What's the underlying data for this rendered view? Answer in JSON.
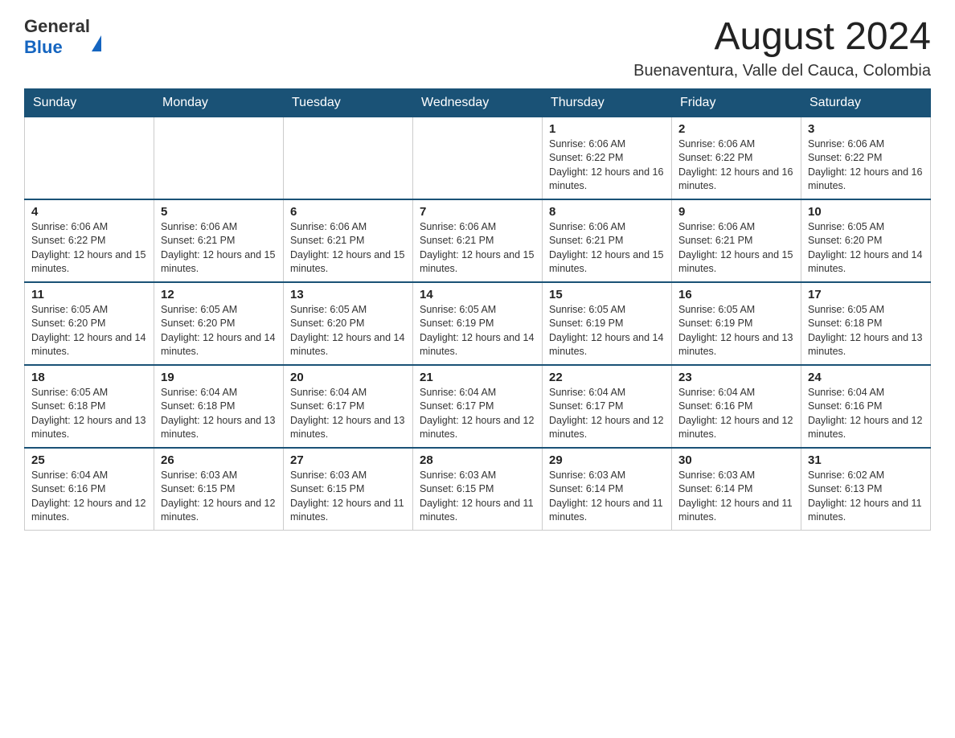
{
  "header": {
    "logo_general": "General",
    "logo_blue": "Blue",
    "month_title": "August 2024",
    "subtitle": "Buenaventura, Valle del Cauca, Colombia"
  },
  "days_of_week": [
    "Sunday",
    "Monday",
    "Tuesday",
    "Wednesday",
    "Thursday",
    "Friday",
    "Saturday"
  ],
  "weeks": [
    [
      {
        "day": "",
        "sunrise": "",
        "sunset": "",
        "daylight": ""
      },
      {
        "day": "",
        "sunrise": "",
        "sunset": "",
        "daylight": ""
      },
      {
        "day": "",
        "sunrise": "",
        "sunset": "",
        "daylight": ""
      },
      {
        "day": "",
        "sunrise": "",
        "sunset": "",
        "daylight": ""
      },
      {
        "day": "1",
        "sunrise": "Sunrise: 6:06 AM",
        "sunset": "Sunset: 6:22 PM",
        "daylight": "Daylight: 12 hours and 16 minutes."
      },
      {
        "day": "2",
        "sunrise": "Sunrise: 6:06 AM",
        "sunset": "Sunset: 6:22 PM",
        "daylight": "Daylight: 12 hours and 16 minutes."
      },
      {
        "day": "3",
        "sunrise": "Sunrise: 6:06 AM",
        "sunset": "Sunset: 6:22 PM",
        "daylight": "Daylight: 12 hours and 16 minutes."
      }
    ],
    [
      {
        "day": "4",
        "sunrise": "Sunrise: 6:06 AM",
        "sunset": "Sunset: 6:22 PM",
        "daylight": "Daylight: 12 hours and 15 minutes."
      },
      {
        "day": "5",
        "sunrise": "Sunrise: 6:06 AM",
        "sunset": "Sunset: 6:21 PM",
        "daylight": "Daylight: 12 hours and 15 minutes."
      },
      {
        "day": "6",
        "sunrise": "Sunrise: 6:06 AM",
        "sunset": "Sunset: 6:21 PM",
        "daylight": "Daylight: 12 hours and 15 minutes."
      },
      {
        "day": "7",
        "sunrise": "Sunrise: 6:06 AM",
        "sunset": "Sunset: 6:21 PM",
        "daylight": "Daylight: 12 hours and 15 minutes."
      },
      {
        "day": "8",
        "sunrise": "Sunrise: 6:06 AM",
        "sunset": "Sunset: 6:21 PM",
        "daylight": "Daylight: 12 hours and 15 minutes."
      },
      {
        "day": "9",
        "sunrise": "Sunrise: 6:06 AM",
        "sunset": "Sunset: 6:21 PM",
        "daylight": "Daylight: 12 hours and 15 minutes."
      },
      {
        "day": "10",
        "sunrise": "Sunrise: 6:05 AM",
        "sunset": "Sunset: 6:20 PM",
        "daylight": "Daylight: 12 hours and 14 minutes."
      }
    ],
    [
      {
        "day": "11",
        "sunrise": "Sunrise: 6:05 AM",
        "sunset": "Sunset: 6:20 PM",
        "daylight": "Daylight: 12 hours and 14 minutes."
      },
      {
        "day": "12",
        "sunrise": "Sunrise: 6:05 AM",
        "sunset": "Sunset: 6:20 PM",
        "daylight": "Daylight: 12 hours and 14 minutes."
      },
      {
        "day": "13",
        "sunrise": "Sunrise: 6:05 AM",
        "sunset": "Sunset: 6:20 PM",
        "daylight": "Daylight: 12 hours and 14 minutes."
      },
      {
        "day": "14",
        "sunrise": "Sunrise: 6:05 AM",
        "sunset": "Sunset: 6:19 PM",
        "daylight": "Daylight: 12 hours and 14 minutes."
      },
      {
        "day": "15",
        "sunrise": "Sunrise: 6:05 AM",
        "sunset": "Sunset: 6:19 PM",
        "daylight": "Daylight: 12 hours and 14 minutes."
      },
      {
        "day": "16",
        "sunrise": "Sunrise: 6:05 AM",
        "sunset": "Sunset: 6:19 PM",
        "daylight": "Daylight: 12 hours and 13 minutes."
      },
      {
        "day": "17",
        "sunrise": "Sunrise: 6:05 AM",
        "sunset": "Sunset: 6:18 PM",
        "daylight": "Daylight: 12 hours and 13 minutes."
      }
    ],
    [
      {
        "day": "18",
        "sunrise": "Sunrise: 6:05 AM",
        "sunset": "Sunset: 6:18 PM",
        "daylight": "Daylight: 12 hours and 13 minutes."
      },
      {
        "day": "19",
        "sunrise": "Sunrise: 6:04 AM",
        "sunset": "Sunset: 6:18 PM",
        "daylight": "Daylight: 12 hours and 13 minutes."
      },
      {
        "day": "20",
        "sunrise": "Sunrise: 6:04 AM",
        "sunset": "Sunset: 6:17 PM",
        "daylight": "Daylight: 12 hours and 13 minutes."
      },
      {
        "day": "21",
        "sunrise": "Sunrise: 6:04 AM",
        "sunset": "Sunset: 6:17 PM",
        "daylight": "Daylight: 12 hours and 12 minutes."
      },
      {
        "day": "22",
        "sunrise": "Sunrise: 6:04 AM",
        "sunset": "Sunset: 6:17 PM",
        "daylight": "Daylight: 12 hours and 12 minutes."
      },
      {
        "day": "23",
        "sunrise": "Sunrise: 6:04 AM",
        "sunset": "Sunset: 6:16 PM",
        "daylight": "Daylight: 12 hours and 12 minutes."
      },
      {
        "day": "24",
        "sunrise": "Sunrise: 6:04 AM",
        "sunset": "Sunset: 6:16 PM",
        "daylight": "Daylight: 12 hours and 12 minutes."
      }
    ],
    [
      {
        "day": "25",
        "sunrise": "Sunrise: 6:04 AM",
        "sunset": "Sunset: 6:16 PM",
        "daylight": "Daylight: 12 hours and 12 minutes."
      },
      {
        "day": "26",
        "sunrise": "Sunrise: 6:03 AM",
        "sunset": "Sunset: 6:15 PM",
        "daylight": "Daylight: 12 hours and 12 minutes."
      },
      {
        "day": "27",
        "sunrise": "Sunrise: 6:03 AM",
        "sunset": "Sunset: 6:15 PM",
        "daylight": "Daylight: 12 hours and 11 minutes."
      },
      {
        "day": "28",
        "sunrise": "Sunrise: 6:03 AM",
        "sunset": "Sunset: 6:15 PM",
        "daylight": "Daylight: 12 hours and 11 minutes."
      },
      {
        "day": "29",
        "sunrise": "Sunrise: 6:03 AM",
        "sunset": "Sunset: 6:14 PM",
        "daylight": "Daylight: 12 hours and 11 minutes."
      },
      {
        "day": "30",
        "sunrise": "Sunrise: 6:03 AM",
        "sunset": "Sunset: 6:14 PM",
        "daylight": "Daylight: 12 hours and 11 minutes."
      },
      {
        "day": "31",
        "sunrise": "Sunrise: 6:02 AM",
        "sunset": "Sunset: 6:13 PM",
        "daylight": "Daylight: 12 hours and 11 minutes."
      }
    ]
  ]
}
